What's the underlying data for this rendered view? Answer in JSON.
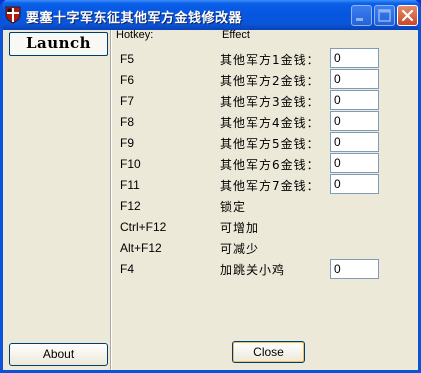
{
  "window": {
    "title": "要塞十字军东征其他军方金钱修改器"
  },
  "sidebar": {
    "launch_label": "Launch",
    "about_label": "About"
  },
  "headers": {
    "hotkey": "Hotkey:",
    "effect": "Effect"
  },
  "rows": [
    {
      "key": "F5",
      "effect": "其他军方1金钱：",
      "value": "0"
    },
    {
      "key": "F6",
      "effect": "其他军方2金钱：",
      "value": "0"
    },
    {
      "key": "F7",
      "effect": "其他军方3金钱：",
      "value": "0"
    },
    {
      "key": "F8",
      "effect": "其他军方4金钱：",
      "value": "0"
    },
    {
      "key": "F9",
      "effect": "其他军方5金钱：",
      "value": "0"
    },
    {
      "key": "F10",
      "effect": "其他军方6金钱：",
      "value": "0"
    },
    {
      "key": "F11",
      "effect": "其他军方7金钱：",
      "value": "0"
    },
    {
      "key": "F12",
      "effect": "锁定"
    },
    {
      "key": "Ctrl+F12",
      "effect": "可增加"
    },
    {
      "key": "Alt+F12",
      "effect": "可减少"
    },
    {
      "key": "F4",
      "effect": "加跳关小鸡",
      "value": "0"
    }
  ],
  "footer": {
    "close_label": "Close"
  },
  "colors": {
    "titlebar": "#0a5fe8",
    "face": "#ece9d8",
    "close_button": "#c8482a"
  },
  "icons": {
    "app": "shield-icon",
    "minimize": "minimize-icon",
    "maximize": "maximize-icon",
    "close": "close-icon"
  }
}
